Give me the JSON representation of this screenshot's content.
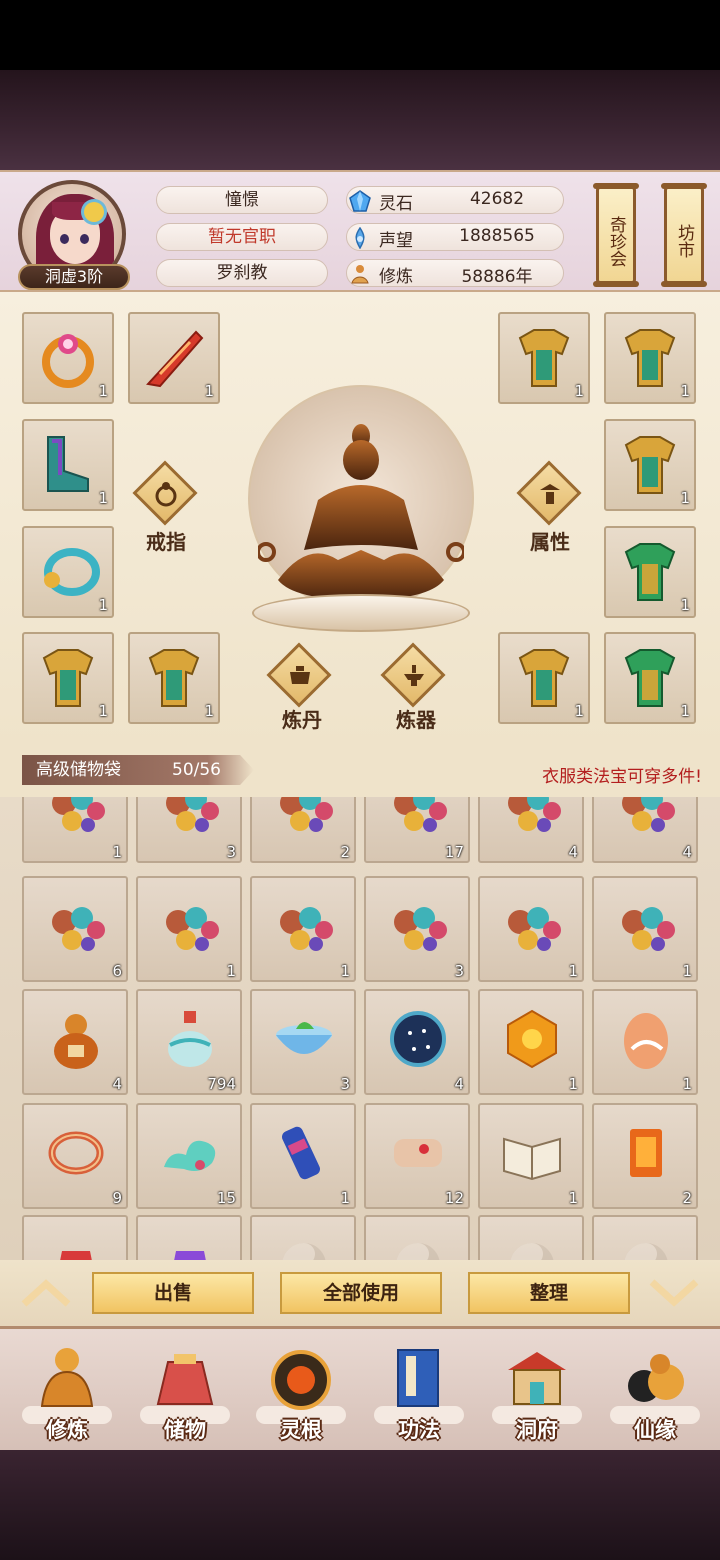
{
  "header": {
    "rank": "洞虚3阶",
    "name": "憧憬",
    "title": "暂无官职",
    "sect": "罗刹教",
    "stats": [
      {
        "label": "灵石",
        "value": "42682",
        "icon": "spirit-stone-icon"
      },
      {
        "label": "声望",
        "value": "1888565",
        "icon": "prestige-icon"
      },
      {
        "label": "修炼",
        "value": "58886年",
        "icon": "cultivation-icon"
      }
    ],
    "side_buttons": [
      "奇珍会",
      "坊市"
    ]
  },
  "equipment": {
    "slots": [
      {
        "id": "ring-slot",
        "icon": "magic-ring-icon",
        "count": "1"
      },
      {
        "id": "weapon-slot",
        "icon": "flame-blade-icon",
        "count": "1"
      },
      {
        "id": "boots-slot",
        "icon": "jade-boots-icon",
        "count": "1"
      },
      {
        "id": "bracelet-slot",
        "icon": "jade-bracelet-icon",
        "count": "1"
      },
      {
        "id": "armor-slot-l1",
        "icon": "gold-armor-icon",
        "count": "1"
      },
      {
        "id": "armor-slot-l2",
        "icon": "gold-armor-icon",
        "count": "1"
      },
      {
        "id": "armor-slot-r1",
        "icon": "gold-armor-icon",
        "count": "1"
      },
      {
        "id": "armor-slot-r2",
        "icon": "gold-armor-icon",
        "count": "1"
      },
      {
        "id": "armor-slot-r3",
        "icon": "gold-armor-icon",
        "count": "1"
      },
      {
        "id": "armor-slot-r4",
        "icon": "green-armor-icon",
        "count": "1"
      },
      {
        "id": "armor-slot-r5",
        "icon": "gold-armor-icon",
        "count": "1"
      },
      {
        "id": "armor-slot-r6",
        "icon": "green-armor-icon",
        "count": "1"
      }
    ],
    "buttons": {
      "ring": "戒指",
      "attributes": "属性",
      "alchemy": "炼丹",
      "forging": "炼器"
    }
  },
  "bag": {
    "title": "高级储物袋",
    "capacity": "50/56",
    "note": "衣服类法宝可穿多件!",
    "rows": [
      [
        {
          "icon": "spirit-beads-icon",
          "count": "1"
        },
        {
          "icon": "spirit-beads-icon",
          "count": "3"
        },
        {
          "icon": "spirit-beads-icon",
          "count": "2"
        },
        {
          "icon": "spirit-beads-icon",
          "count": "17"
        },
        {
          "icon": "spirit-beads-icon",
          "count": "4"
        },
        {
          "icon": "spirit-beads-icon",
          "count": "4"
        }
      ],
      [
        {
          "icon": "spirit-beads-icon",
          "count": "6"
        },
        {
          "icon": "spirit-beads-icon",
          "count": "1"
        },
        {
          "icon": "spirit-beads-icon",
          "count": "1"
        },
        {
          "icon": "spirit-beads-icon",
          "count": "3"
        },
        {
          "icon": "spirit-beads-icon",
          "count": "1"
        },
        {
          "icon": "spirit-beads-icon",
          "count": "1"
        }
      ],
      [
        {
          "icon": "gourd-icon",
          "count": "4"
        },
        {
          "icon": "potion-bottle-icon",
          "count": "794"
        },
        {
          "icon": "tea-bowl-icon",
          "count": "3"
        },
        {
          "icon": "star-compass-icon",
          "count": "4"
        },
        {
          "icon": "amber-gem-icon",
          "count": "1"
        },
        {
          "icon": "fox-egg-icon",
          "count": "1"
        }
      ],
      [
        {
          "icon": "red-ring-icon",
          "count": "9"
        },
        {
          "icon": "jade-cloud-icon",
          "count": "15"
        },
        {
          "icon": "scroll-case-icon",
          "count": "1"
        },
        {
          "icon": "paper-scroll-icon",
          "count": "12"
        },
        {
          "icon": "book-icon",
          "count": "1"
        },
        {
          "icon": "talisman-icon",
          "count": "2"
        }
      ],
      [
        {
          "icon": "red-pouch-icon",
          "count": ""
        },
        {
          "icon": "purple-pouch-icon",
          "count": ""
        },
        {
          "icon": "empty-slot-icon",
          "count": ""
        },
        {
          "icon": "empty-slot-icon",
          "count": ""
        },
        {
          "icon": "empty-slot-icon",
          "count": ""
        },
        {
          "icon": "empty-slot-icon",
          "count": ""
        }
      ]
    ]
  },
  "actions": {
    "sell": "出售",
    "use_all": "全部使用",
    "sort": "整理"
  },
  "nav": [
    {
      "label": "修炼",
      "icon": "cultivation-nav-icon"
    },
    {
      "label": "储物",
      "icon": "storage-bag-icon"
    },
    {
      "label": "灵根",
      "icon": "spirit-root-icon"
    },
    {
      "label": "功法",
      "icon": "technique-book-icon"
    },
    {
      "label": "洞府",
      "icon": "cave-house-icon"
    },
    {
      "label": "仙缘",
      "icon": "immortal-fate-icon"
    }
  ],
  "colors": {
    "accent_red": "#b31e1e",
    "gold": "#f1c462",
    "panel": "#efe3ca"
  }
}
